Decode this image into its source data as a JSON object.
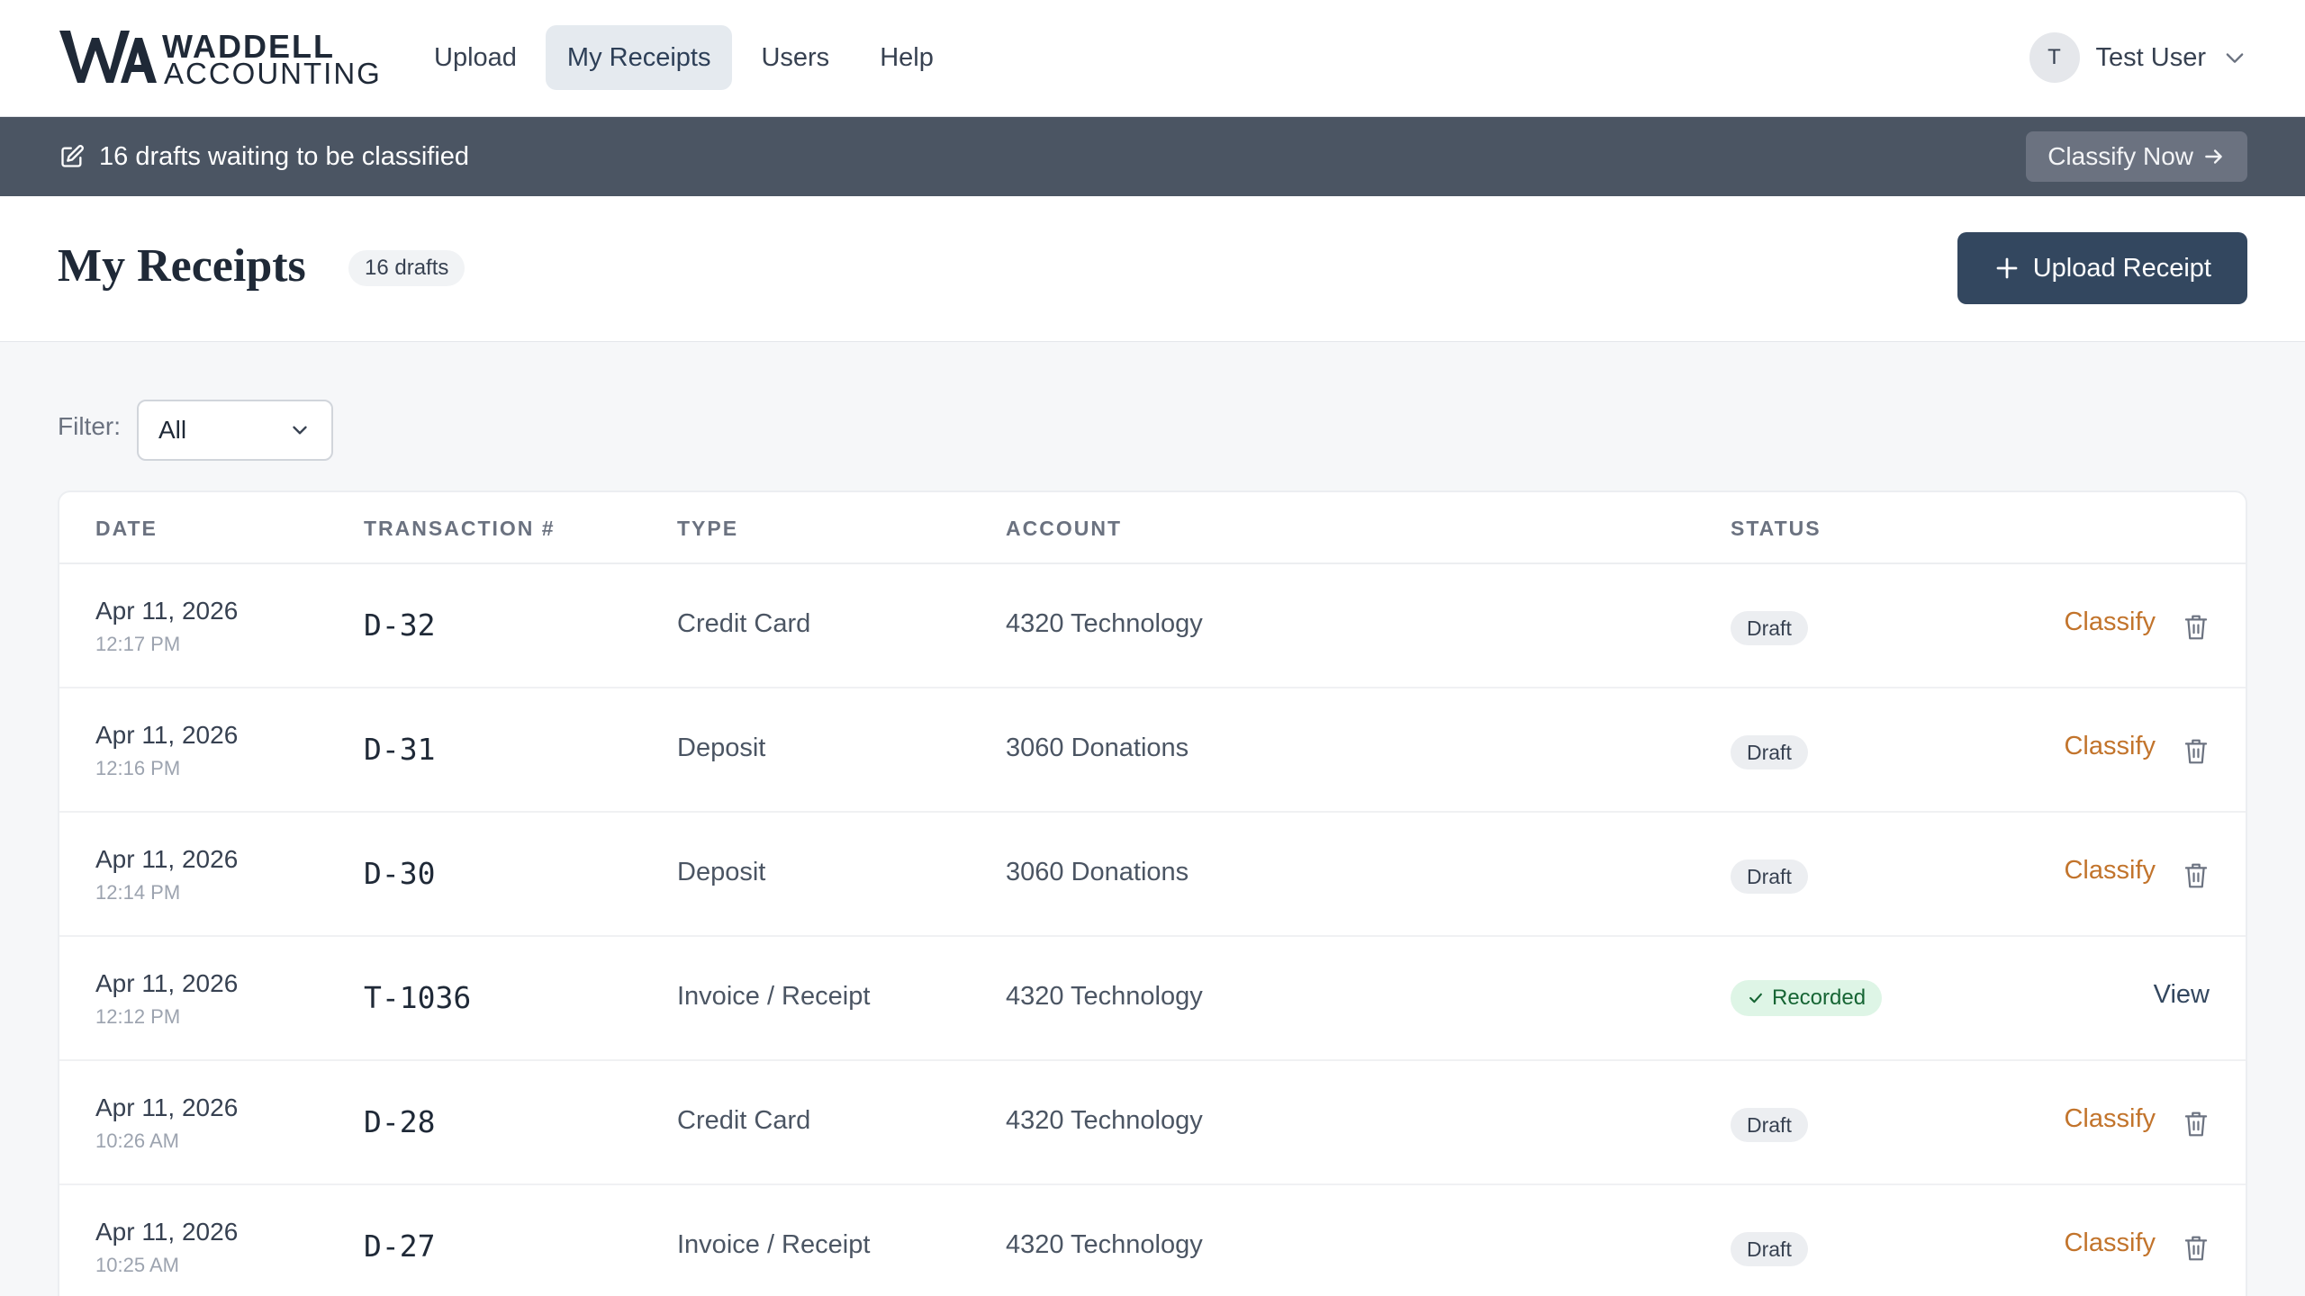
{
  "brand": {
    "line1": "WADDELL",
    "line2": "ACCOUNTING"
  },
  "nav": [
    {
      "label": "Upload",
      "active": false
    },
    {
      "label": "My Receipts",
      "active": true
    },
    {
      "label": "Users",
      "active": false
    },
    {
      "label": "Help",
      "active": false
    }
  ],
  "user": {
    "initial": "T",
    "name": "Test User"
  },
  "banner": {
    "text": "16 drafts waiting to be classified",
    "button": "Classify Now"
  },
  "page": {
    "title": "My Receipts",
    "badge": "16 drafts",
    "upload_button": "Upload Receipt"
  },
  "filter": {
    "label": "Filter:",
    "value": "All"
  },
  "table": {
    "headers": {
      "date": "DATE",
      "txn": "TRANSACTION #",
      "type": "TYPE",
      "account": "ACCOUNT",
      "status": "STATUS"
    },
    "rows": [
      {
        "date": "Apr 11, 2026",
        "time": "12:17 PM",
        "txn": "D-32",
        "type": "Credit Card",
        "account": "4320 Technology",
        "status": "Draft",
        "action": "Classify"
      },
      {
        "date": "Apr 11, 2026",
        "time": "12:16 PM",
        "txn": "D-31",
        "type": "Deposit",
        "account": "3060 Donations",
        "status": "Draft",
        "action": "Classify"
      },
      {
        "date": "Apr 11, 2026",
        "time": "12:14 PM",
        "txn": "D-30",
        "type": "Deposit",
        "account": "3060 Donations",
        "status": "Draft",
        "action": "Classify"
      },
      {
        "date": "Apr 11, 2026",
        "time": "12:12 PM",
        "txn": "T-1036",
        "type": "Invoice / Receipt",
        "account": "4320 Technology",
        "status": "Recorded",
        "action": "View"
      },
      {
        "date": "Apr 11, 2026",
        "time": "10:26 AM",
        "txn": "D-28",
        "type": "Credit Card",
        "account": "4320 Technology",
        "status": "Draft",
        "action": "Classify"
      },
      {
        "date": "Apr 11, 2026",
        "time": "10:25 AM",
        "txn": "D-27",
        "type": "Invoice / Receipt",
        "account": "4320 Technology",
        "status": "Draft",
        "action": "Classify"
      }
    ]
  },
  "colors": {
    "primary": "#33475f",
    "banner": "#4b5563",
    "classify": "#c2742c",
    "recorded_bg": "#def5e6"
  }
}
